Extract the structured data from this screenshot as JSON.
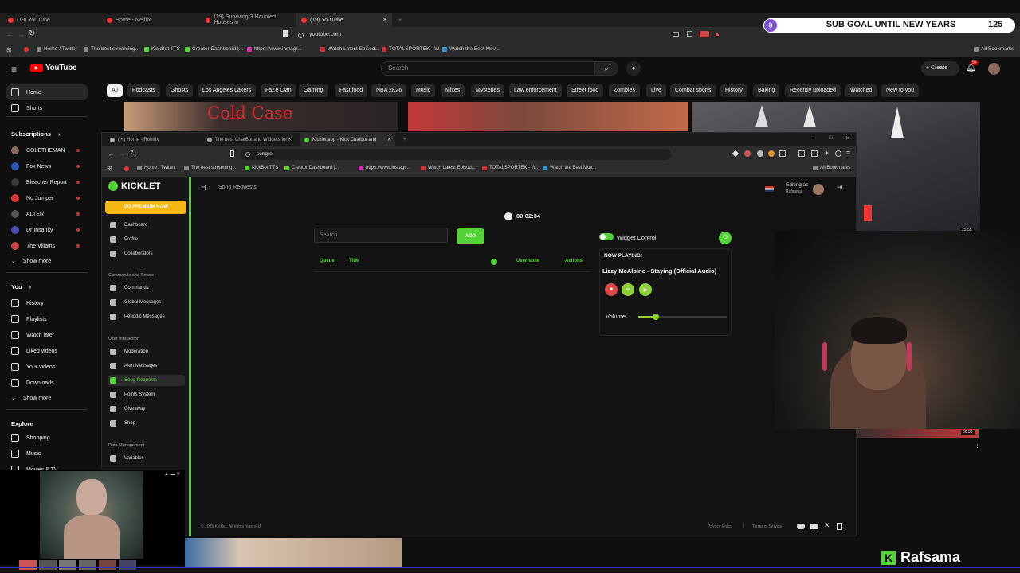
{
  "outer_browser": {
    "tabs": [
      {
        "title": "(19) YouTube",
        "active": false
      },
      {
        "title": "Home - Netflix",
        "active": false
      },
      {
        "title": "(19) Surviving 3 Haunted Houses in",
        "active": false
      },
      {
        "title": "(19) YouTube",
        "active": true
      }
    ],
    "url": "youtube.com",
    "bookmarks": [
      "Home / Twitter",
      "The best streaming...",
      "KickBot TTS",
      "Creator Dashboard |...",
      "https://www.instagr...",
      "Watch Latest Episod...",
      "TOTALSPORTEK - W...",
      "Watch the Best Mov..."
    ],
    "all_bookmarks": "All Bookmarks"
  },
  "overlay": {
    "sub_goal_count": "0",
    "sub_goal_label": "SUB GOAL UNTIL NEW YEARS",
    "sub_goal_target": "125",
    "streamer_name": "Rafsama"
  },
  "youtube": {
    "logo": "YouTube",
    "search_placeholder": "Search",
    "create_label": "Create",
    "notif_count": "9+",
    "chips": [
      "All",
      "Podcasts",
      "Ghosts",
      "Los Angeles Lakers",
      "FaZe Clan",
      "Gaming",
      "Fast food",
      "NBA 2K26",
      "Music",
      "Mixes",
      "Mysteries",
      "Law enforcement",
      "Street food",
      "Zombies",
      "Live",
      "Combat sports",
      "History",
      "Baking",
      "Recently uploaded",
      "Watched",
      "New to you"
    ],
    "sidebar": {
      "home": "Home",
      "shorts": "Shorts",
      "subscriptions_title": "Subscriptions",
      "subscriptions": [
        "COLETHEMAN",
        "Fox News",
        "Bleacher Report",
        "No Jumper",
        "ALTER",
        "Dr Insanity",
        "The Villains"
      ],
      "show_more": "Show more",
      "you_title": "You",
      "you_items": [
        "History",
        "Playlists",
        "Watch later",
        "Liked videos",
        "Your videos",
        "Downloads"
      ],
      "show_more_2": "Show more",
      "explore_title": "Explore",
      "explore_items": [
        "Shopping",
        "Music",
        "Movies & TV"
      ]
    },
    "thumb_text": "Cold Case",
    "video_time_1": "25:55",
    "video_time_2": "30:30"
  },
  "kicklet_browser": {
    "tabs": [
      {
        "title": "( • ) Home - Roblox",
        "active": false
      },
      {
        "title": "The best ChatBot and Widgets for Ki",
        "active": false
      },
      {
        "title": "Kicklet.app - Kick Chatbot and ",
        "active": true
      }
    ],
    "url": "songre",
    "bookmarks": [
      "Home / Twitter",
      "The best streaming...",
      "KickBot TTS",
      "Creator Dashboard |...",
      "https://www.instagr...",
      "Watch Latest Episod...",
      "TOTALSPORTEK - W...",
      "Watch the Best Mov..."
    ],
    "all_bookmarks": "All Bookmarks"
  },
  "kicklet": {
    "logo": "KICKLET",
    "premium_button": "GO PREMIUM NOW",
    "nav_top": [
      "Dashboard",
      "Profile",
      "Collaborators"
    ],
    "section_commands": "Commands and Timers",
    "nav_commands": [
      "Commands",
      "Global Messages",
      "Periodic Messages"
    ],
    "section_interaction": "User Interaction",
    "nav_interaction": [
      "Moderation",
      "Alert Messages",
      "Song Requests",
      "Points System",
      "Giveaway",
      "Shop"
    ],
    "section_data": "Data Management",
    "nav_data": [
      "Variables"
    ],
    "page_title": "Song Requests",
    "editing_as_label": "Editing as",
    "editing_as_user": "Rafsama",
    "timer": "00:02:34",
    "search_placeholder": "Search",
    "add_button": "ADD",
    "table_headers": [
      "Queue",
      "Title",
      "Username",
      "Actions"
    ],
    "widget_control_label": "Widget Control",
    "now_playing_label": "NOW PLAYING:",
    "now_playing_track": "Lizzy McAlpine - Staying (Official Audio)",
    "volume_label": "Volume",
    "volume_level": 0.2,
    "footer_copyright": "© 2025 Kicklet. All rights reserved.",
    "footer_links": [
      "Privacy Policy",
      "Terms of Service"
    ]
  }
}
